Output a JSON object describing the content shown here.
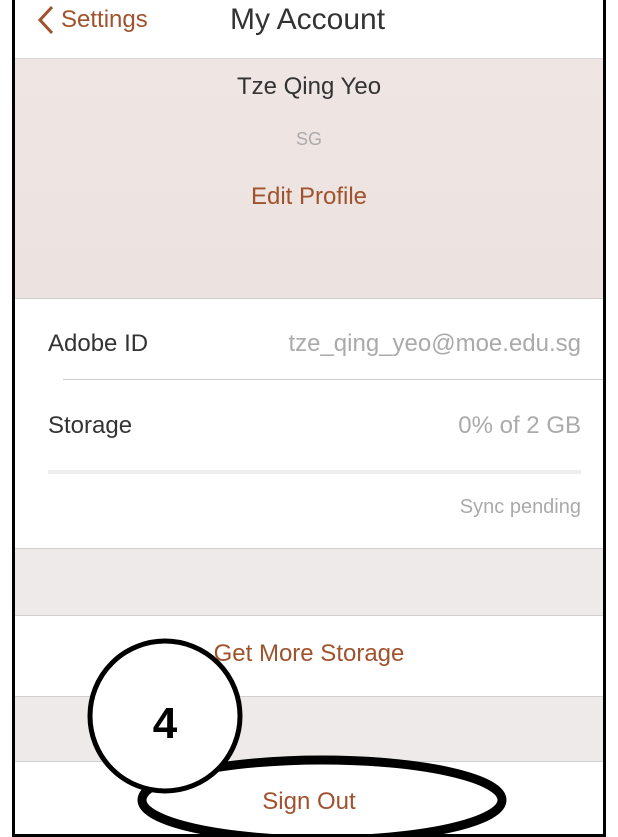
{
  "navbar": {
    "back_label": "Settings",
    "title": "My Account"
  },
  "profile": {
    "name": "Tze Qing Yeo",
    "region": "SG",
    "edit_label": "Edit Profile"
  },
  "account": {
    "adobe_id_label": "Adobe ID",
    "adobe_id_value": "tze_qing_yeo@moe.edu.sg",
    "storage_label": "Storage",
    "storage_value": "0% of 2 GB",
    "storage_used_fraction": 0,
    "sync_status": "Sync pending"
  },
  "actions": {
    "get_more_storage": "Get More Storage",
    "sign_out": "Sign Out"
  },
  "annotation": {
    "step_number": "4"
  },
  "colors": {
    "accent": "#a0522d",
    "header_bg": "#efe6e4",
    "band_bg": "#eeeaea"
  }
}
